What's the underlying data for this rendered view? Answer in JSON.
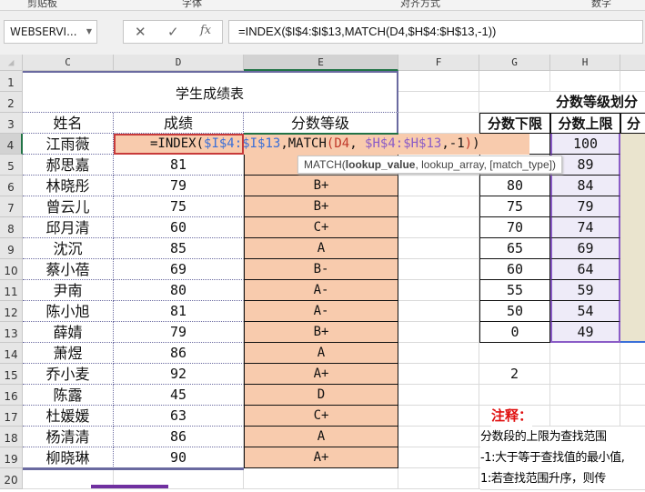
{
  "ribbon": {
    "groups": [
      "剪贴板",
      "字体",
      "对齐方式",
      "数字"
    ]
  },
  "formula_bar": {
    "name_box": "WEBSERVI...",
    "cancel": "✕",
    "enter": "✓",
    "fx": "fx",
    "formula": "=INDEX($I$4:$I$13,MATCH(D4,$H$4:$H$13,-1))"
  },
  "columns": [
    "C",
    "D",
    "E",
    "F",
    "G",
    "H"
  ],
  "selected_column": "E",
  "rows": [
    "1",
    "2",
    "3",
    "4",
    "5",
    "6",
    "7",
    "8",
    "9",
    "10",
    "11",
    "12",
    "13",
    "14",
    "15",
    "16",
    "17",
    "18",
    "19",
    "20"
  ],
  "table": {
    "title": "学生成绩表",
    "headers": [
      "姓名",
      "成绩",
      "分数等级"
    ],
    "students": [
      {
        "name": "江雨薇",
        "score": "",
        "grade": ""
      },
      {
        "name": "郝思嘉",
        "score": "81",
        "grade": ""
      },
      {
        "name": "林晓彤",
        "score": "79",
        "grade": "B+"
      },
      {
        "name": "曾云儿",
        "score": "75",
        "grade": "B+"
      },
      {
        "name": "邱月清",
        "score": "60",
        "grade": "C+"
      },
      {
        "name": "沈沉",
        "score": "85",
        "grade": "A"
      },
      {
        "name": "蔡小蓓",
        "score": "69",
        "grade": "B-"
      },
      {
        "name": "尹南",
        "score": "80",
        "grade": "A-"
      },
      {
        "name": "陈小旭",
        "score": "81",
        "grade": "A-"
      },
      {
        "name": "薛婧",
        "score": "79",
        "grade": "B+"
      },
      {
        "name": "萧煜",
        "score": "86",
        "grade": "A"
      },
      {
        "name": "乔小麦",
        "score": "92",
        "grade": "A+"
      },
      {
        "name": "陈露",
        "score": "45",
        "grade": "D"
      },
      {
        "name": "杜媛媛",
        "score": "63",
        "grade": "C+"
      },
      {
        "name": "杨清清",
        "score": "86",
        "grade": "A"
      },
      {
        "name": "柳晓琳",
        "score": "90",
        "grade": "A+"
      }
    ]
  },
  "edit_cell": {
    "parts": [
      {
        "t": "=INDEX(",
        "c": "#111"
      },
      {
        "t": "$I$4:$I$13",
        "c": "#3a6fd8"
      },
      {
        "t": ",MATCH",
        "c": "#111"
      },
      {
        "t": "(",
        "c": "#c0392b"
      },
      {
        "t": "D4",
        "c": "#c0392b"
      },
      {
        "t": ", ",
        "c": "#111"
      },
      {
        "t": "$H$4:$H$13",
        "c": "#8a5cc7"
      },
      {
        "t": ",-1",
        "c": "#111"
      },
      {
        "t": ")",
        "c": "#c0392b"
      },
      {
        "t": ")",
        "c": "#111"
      }
    ]
  },
  "tooltip": {
    "fn": "MATCH(",
    "arg1": "lookup_value",
    "rest": ", lookup_array, [match_type])"
  },
  "grade_table": {
    "title": "分数等级划分",
    "headers": [
      "分数下限",
      "分数上限",
      "分"
    ],
    "lower": [
      "",
      "",
      "80",
      "75",
      "70",
      "65",
      "60",
      "55",
      "50",
      "0"
    ],
    "upper": [
      "100",
      "89",
      "84",
      "79",
      "74",
      "69",
      "64",
      "59",
      "54",
      "49"
    ]
  },
  "g15": "2",
  "notes": {
    "title": "注释：",
    "lines": [
      "分数段的上限为查找范围",
      "-1:大于等于查找值的最小值,",
      "1:若查找范围升序，则传"
    ]
  },
  "colors": {
    "grade_fill": "#F8CBAD",
    "upper_fill": "#EEEBF8",
    "i_fill": "#EAE4CE",
    "accent": "#217346"
  }
}
